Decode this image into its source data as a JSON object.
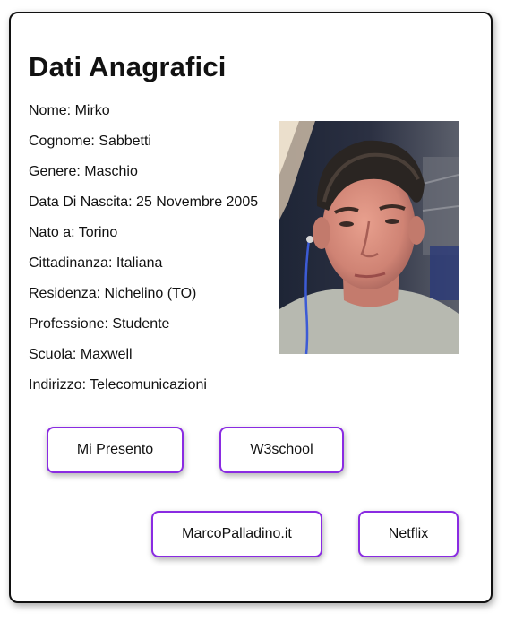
{
  "profile": {
    "title": "Dati Anagrafici",
    "fields": [
      "Nome: Mirko",
      "Cognome: Sabbetti",
      "Genere: Maschio",
      "Data Di Nascita: 25 Novembre 2005",
      "Nato a: Torino",
      "Cittadinanza: Italiana",
      "Residenza: Nichelino (TO)",
      "Professione: Studente",
      "Scuola: Maxwell",
      "Indirizzo: Telecomunicazioni"
    ],
    "photo_icon": "profile-photo"
  },
  "buttons": {
    "mi_presento": "Mi Presento",
    "w3school": "W3school",
    "marcopalladino": "MarcoPalladino.it",
    "netflix": "Netflix"
  },
  "colors": {
    "button_border": "#8a2be2",
    "card_border": "#111111",
    "text": "#111111"
  }
}
